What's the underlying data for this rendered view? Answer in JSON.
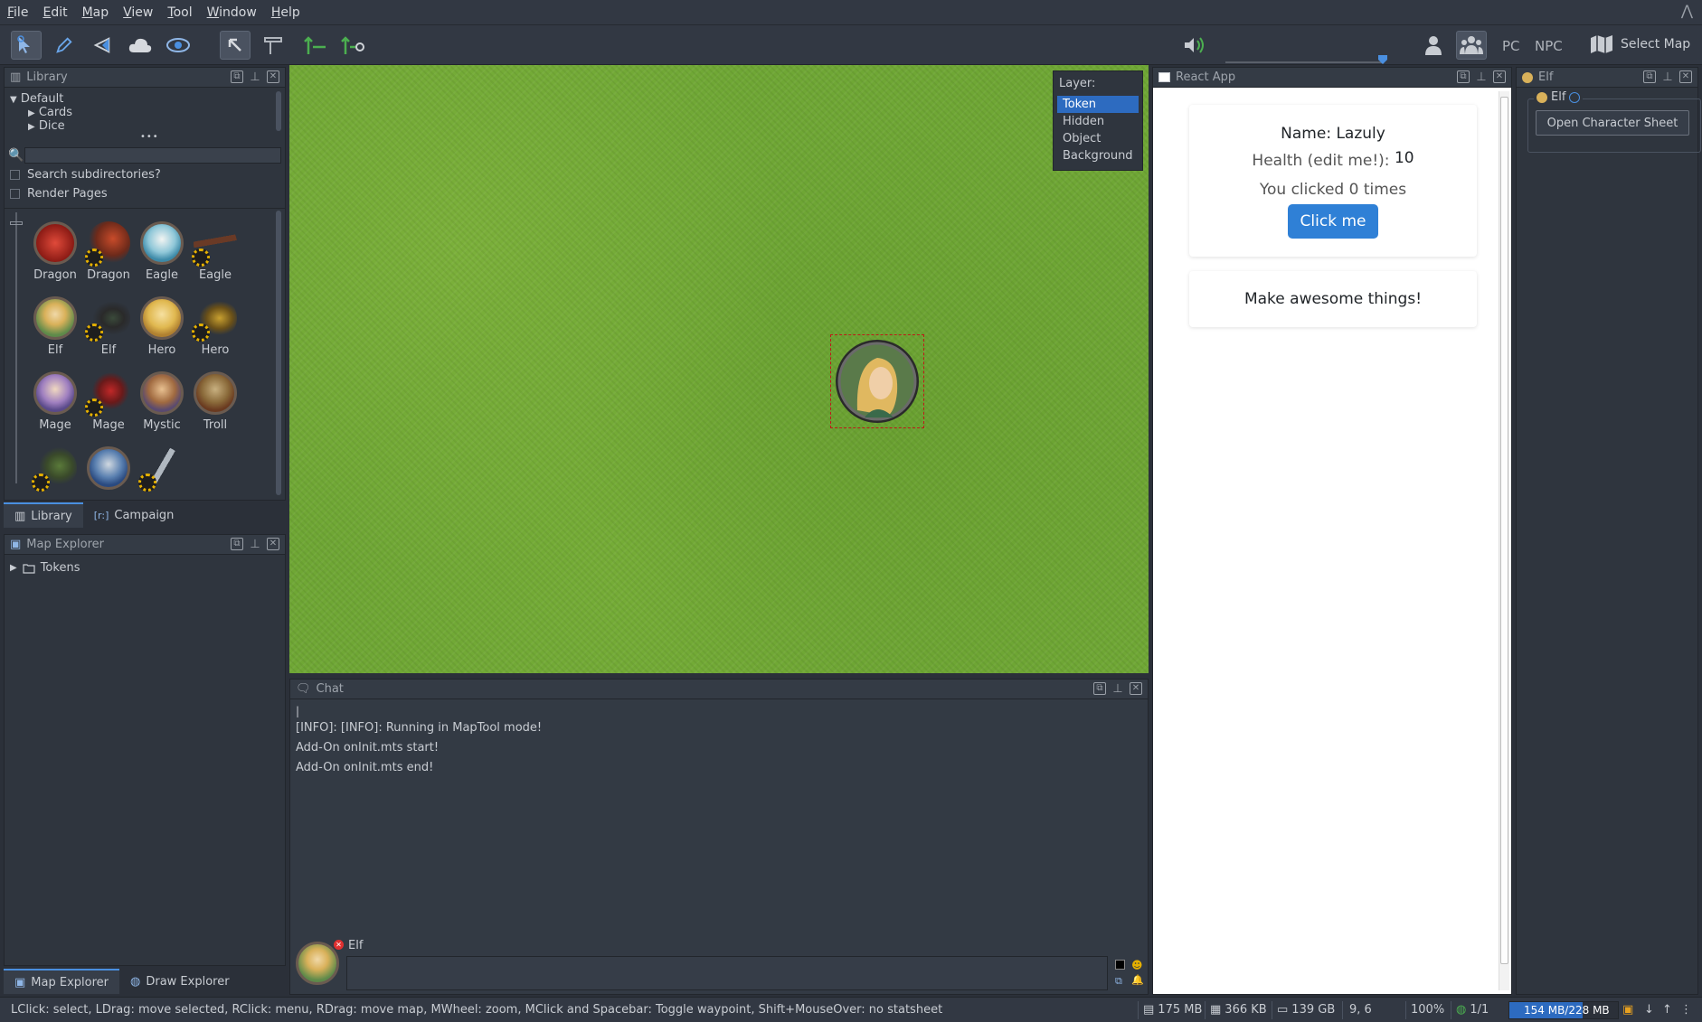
{
  "menu": [
    "File",
    "Edit",
    "Map",
    "View",
    "Tool",
    "Window",
    "Help"
  ],
  "toolbar": {
    "volume_min": "0",
    "volume_max": "100",
    "volume_level": 1.0,
    "pc_label": "PC",
    "npc_label": "NPC",
    "select_map_label": "Select Map"
  },
  "library": {
    "title": "Library",
    "tree": {
      "root": "Default",
      "children": [
        "Cards",
        "Dice"
      ]
    },
    "more": "•••",
    "search_value": "",
    "search_subdirs_label": "Search subdirectories?",
    "render_pages_label": "Render Pages",
    "items": [
      {
        "label": "Dragon"
      },
      {
        "label": "Dragon"
      },
      {
        "label": "Eagle"
      },
      {
        "label": "Eagle"
      },
      {
        "label": "Elf"
      },
      {
        "label": "Elf"
      },
      {
        "label": "Hero"
      },
      {
        "label": "Hero"
      },
      {
        "label": "Mage"
      },
      {
        "label": "Mage"
      },
      {
        "label": "Mystic"
      },
      {
        "label": "Troll"
      }
    ],
    "tabs": [
      "Library",
      "Campaign"
    ],
    "campaign_icon": "[r:]"
  },
  "map_explorer": {
    "title": "Map Explorer",
    "tree_item": "Tokens",
    "tabs": [
      "Map Explorer",
      "Draw Explorer"
    ]
  },
  "layer": {
    "title": "Layer:",
    "options": [
      "Token",
      "Hidden",
      "Object",
      "Background"
    ],
    "selected": "Token"
  },
  "chat": {
    "title": "Chat",
    "cursor": "|",
    "lines": [
      "[INFO]: [INFO]: Running in MapTool mode!",
      "Add-On onInit.mts start!",
      "Add-On onInit.mts end!"
    ],
    "speaker": "Elf",
    "input_value": ""
  },
  "react_app": {
    "title": "React App",
    "name_line": "Name: Lazuly",
    "health_label": "Health (edit me!):",
    "health_value": "10",
    "clicked_text": "You clicked 0 times",
    "button_label": "Click me",
    "tagline": "Make awesome things!"
  },
  "elf_panel": {
    "title": "Elf",
    "token_name": "Elf",
    "button_label": "Open Character Sheet"
  },
  "status": {
    "hint": "LClick: select, LDrag: move selected, RClick: menu, RDrag: move map, MWheel: zoom, MClick and Spacebar: Toggle waypoint, Shift+MouseOver: no statsheet",
    "mem1": "175 MB",
    "mem2": "366 KB",
    "disk": "139 GB",
    "coords": "9, 6",
    "zoom": "100%",
    "players": "1/1",
    "heap": "154 MB/228 MB",
    "heap_fraction": 0.675
  },
  "colors": {
    "accent": "#2d6bc0",
    "button": "#2f80d6",
    "token_border": "#c01818",
    "grass": "#6fa735"
  }
}
